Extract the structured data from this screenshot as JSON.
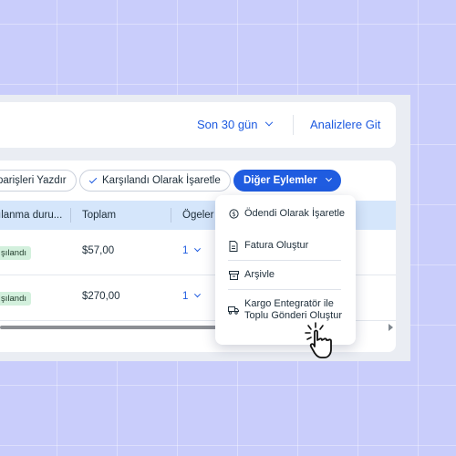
{
  "header": {
    "date_range": "Son 30 gün",
    "analytics_link": "Analizlere Git"
  },
  "actions": {
    "print_orders": "parişleri Yazdır",
    "mark_fulfilled": "Karşılandı Olarak İşaretle",
    "more_actions": "Diğer Eylemler"
  },
  "table": {
    "columns": [
      "ılanma duru...",
      "Toplam",
      "Ögeler"
    ],
    "rows": [
      {
        "status": "şılandı",
        "total": "$57,00",
        "items": "1"
      },
      {
        "status": "şılandı",
        "total": "$270,00",
        "items": "1"
      }
    ]
  },
  "menu": {
    "items": [
      {
        "label": "Ödendi Olarak İşaretle",
        "icon": "dollar-circle-icon"
      },
      {
        "label": "Fatura Oluştur",
        "icon": "document-icon"
      },
      {
        "label": "Arşivle",
        "icon": "archive-icon"
      },
      {
        "label": "Kargo Entegratör ile Toplu Gönderi Oluştur",
        "icon": "truck-icon"
      }
    ]
  },
  "colors": {
    "background": "#c9cdfb",
    "accent": "#1f5ce0",
    "header_row": "#d5e6fb",
    "badge": "#d3f0dd"
  }
}
